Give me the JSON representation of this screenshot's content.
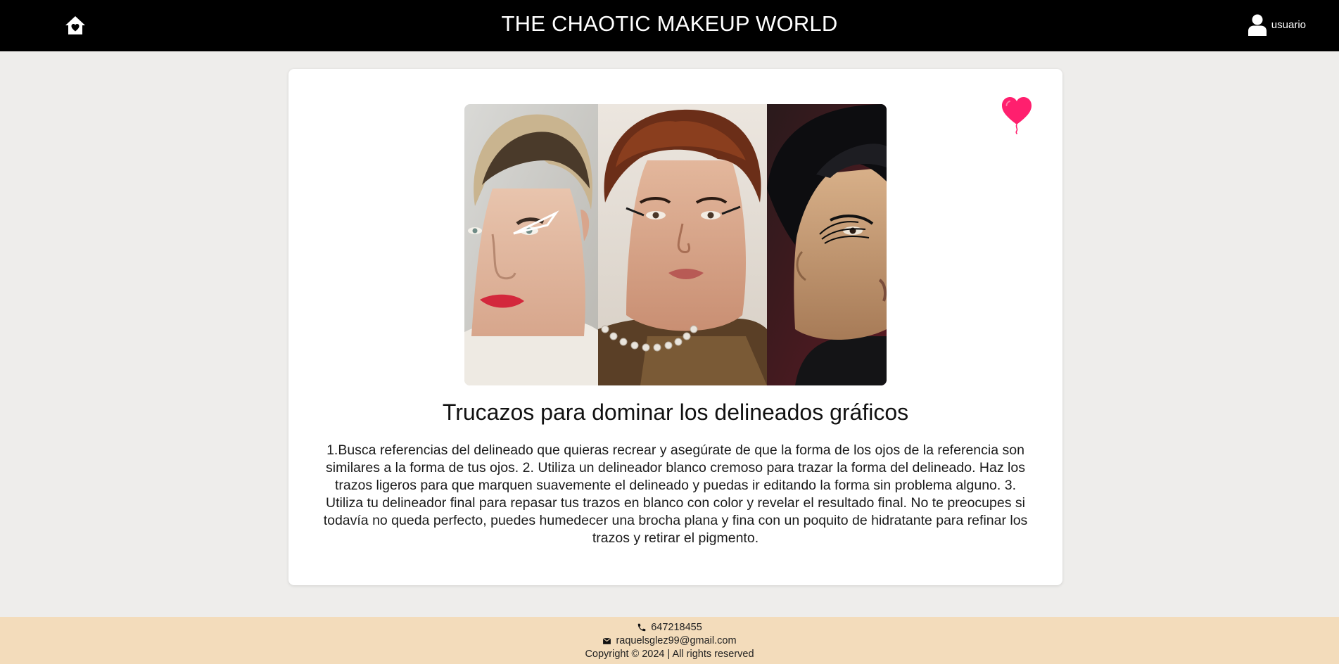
{
  "header": {
    "title": "THE CHAOTIC MAKEUP WORLD",
    "home_icon": "home-heart-icon",
    "user_icon": "user-icon",
    "user_label": "usuario"
  },
  "post": {
    "image_alt": "Tres retratos con delineados gráficos",
    "title": "Trucazos para dominar los delineados gráficos",
    "body": "1.Busca referencias del delineado que quieras recrear y asegúrate de que la forma de los ojos de la referencia son similares a la forma de tus ojos. 2. Utiliza un delineador blanco cremoso para trazar la forma del delineado. Haz los trazos ligeros para que marquen suavemente el delineado y puedas ir editando la forma sin problema alguno. 3. Utiliza tu delineador final para repasar tus trazos en blanco con color y revelar el resultado final. No te preocupes si todavía no queda perfecto, puedes humedecer una brocha plana y fina con un poquito de hidratante para refinar los trazos y retirar el pigmento.",
    "favorite_icon": "heart-balloon-icon",
    "favorite_color": "#ff1f6e"
  },
  "footer": {
    "phone_icon": "phone-icon",
    "phone": "647218455",
    "email_icon": "mail-icon",
    "email": "raquelsglez99@gmail.com",
    "copyright": "Copyright © 2024 | All rights reserved"
  },
  "colors": {
    "header_bg": "#000000",
    "page_bg": "#eeedeb",
    "footer_bg": "#f3dcbb"
  }
}
